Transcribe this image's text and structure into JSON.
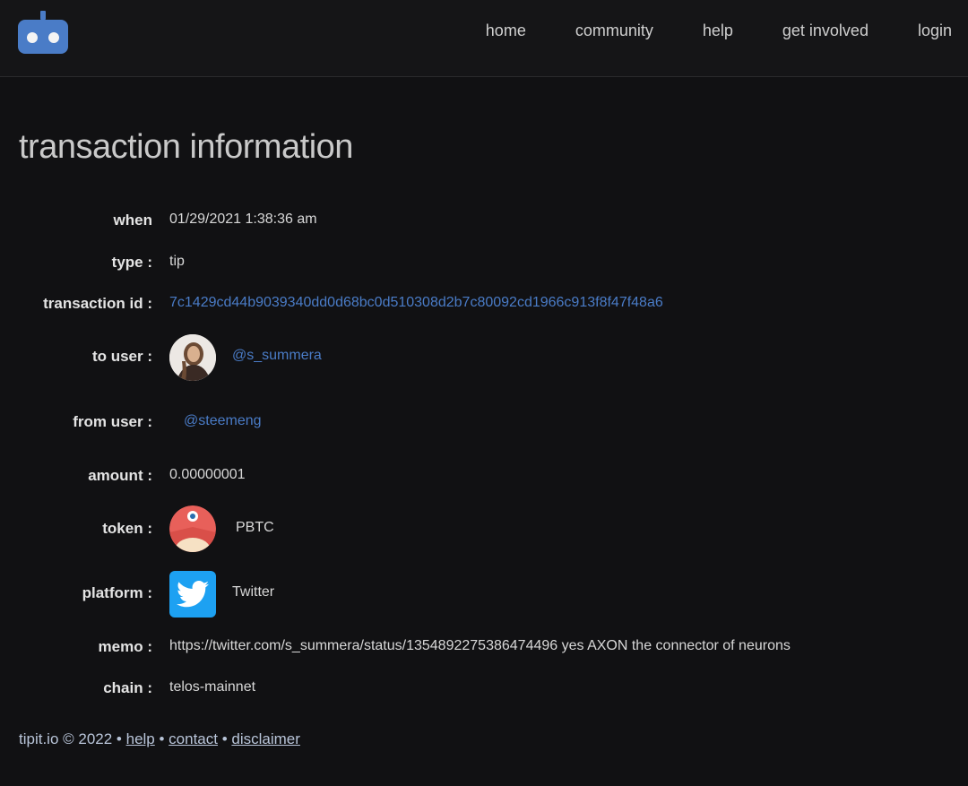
{
  "nav": {
    "home": "home",
    "community": "community",
    "help": "help",
    "get_involved": "get involved",
    "login": "login"
  },
  "page": {
    "title": "transaction information"
  },
  "fields": {
    "when": {
      "label": "when",
      "value": "01/29/2021 1:38:36 am"
    },
    "type": {
      "label": "type :",
      "value": "tip"
    },
    "transaction_id": {
      "label": "transaction id :",
      "value": "7c1429cd44b9039340dd0d68bc0d510308d2b7c80092cd1966c913f8f47f48a6"
    },
    "to_user": {
      "label": "to user :",
      "value": "@s_summera"
    },
    "from_user": {
      "label": "from user :",
      "value": "@steemeng"
    },
    "amount": {
      "label": "amount :",
      "value": "0.00000001"
    },
    "token": {
      "label": "token :",
      "value": "PBTC"
    },
    "platform": {
      "label": "platform :",
      "value": "Twitter"
    },
    "memo": {
      "label": "memo :",
      "value": "https://twitter.com/s_summera/status/1354892275386474496 yes AXON the connector of neurons"
    },
    "chain": {
      "label": "chain :",
      "value": "telos-mainnet"
    }
  },
  "footer": {
    "copyright": "tipit.io © 2022 •",
    "help": "help",
    "sep1": "•",
    "contact": "contact",
    "sep2": "•",
    "disclaimer": "disclaimer"
  },
  "colors": {
    "background": "#111113",
    "link": "#4a7cc7",
    "logo": "#4a7cc7",
    "twitter": "#1da1f2",
    "token": "#e8605a"
  },
  "icons": {
    "logo": "robot-logo-icon",
    "avatar": "user-avatar",
    "token": "pbtc-token-icon",
    "platform": "twitter-icon"
  }
}
